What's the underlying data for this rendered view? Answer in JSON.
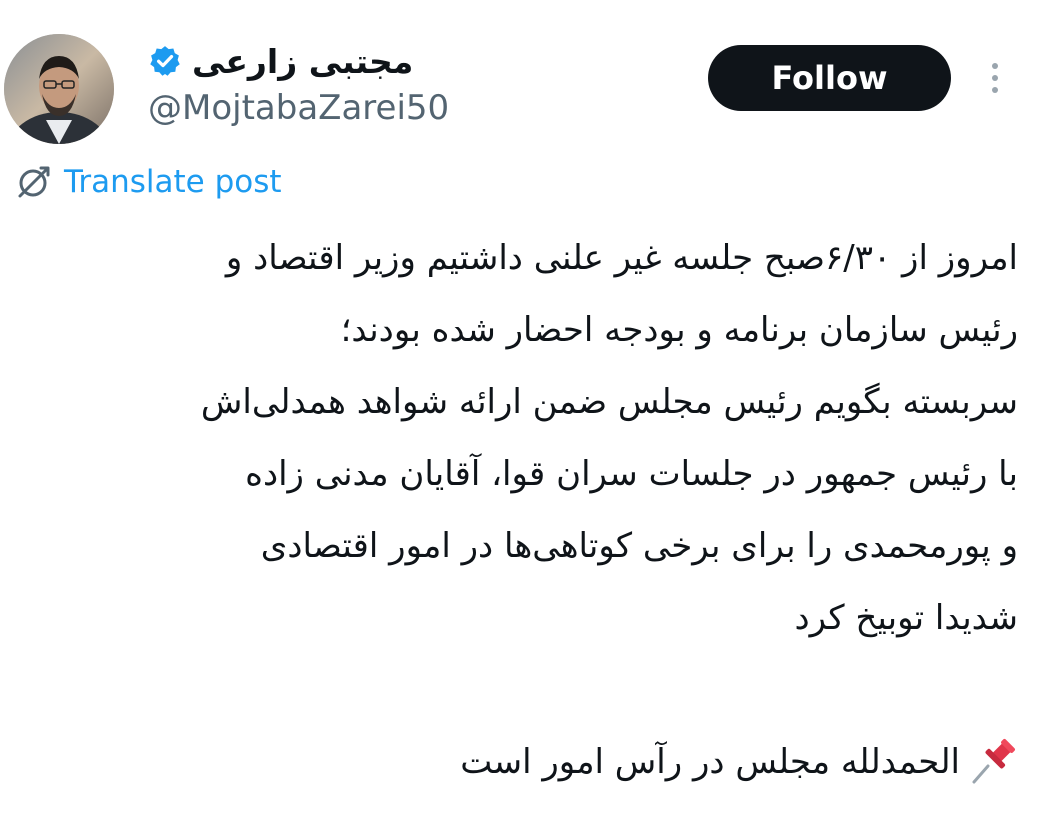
{
  "author": {
    "display_name": "مجتبی زارعی",
    "handle": "@MojtabaZarei50",
    "verified": true
  },
  "actions": {
    "follow_label": "Follow",
    "more_icon": "more-vertical-icon"
  },
  "translate": {
    "label": "Translate post",
    "icon": "translate-icon"
  },
  "post": {
    "lines": [
      "امروز از ۶/۳۰صبح جلسه غیر علنی داشتیم وزیر اقتصاد و",
      "رئیس سازمان برنامه و بودجه احضار شده بودند؛",
      "سربسته بگویم رئیس مجلس ضمن ارائه شواهد همدلی‌اش",
      "با رئیس جمهور در جلسات سران قوا، آقایان مدنی زاده",
      "و پورمحمدی را برای برخی کوتاهی‌ها در امور اقتصادی",
      "شدیدا توبیخ کرد"
    ],
    "closing_line": "الحمدلله مجلس در رآس امور است",
    "closing_icon": "pushpin-icon"
  },
  "colors": {
    "text": "#0f1419",
    "secondary": "#536471",
    "link": "#1d9bf0",
    "verified_badge": "#1d9bf0",
    "follow_bg": "#0f1419",
    "follow_text": "#ffffff"
  }
}
